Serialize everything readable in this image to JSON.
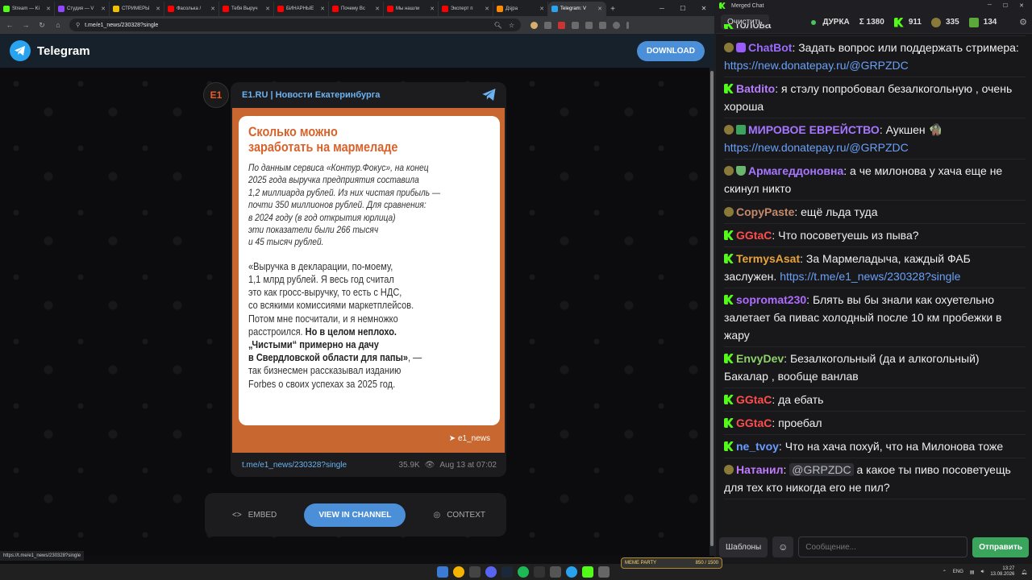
{
  "browser": {
    "tabs": [
      {
        "label": "Stream — Ki",
        "color": "#53fc18"
      },
      {
        "label": "Студия — V",
        "color": "#9146ff"
      },
      {
        "label": "СТРИМЕРЫ",
        "color": "#f0c000"
      },
      {
        "label": "Фасолька /",
        "color": "#ff0000"
      },
      {
        "label": "Тебя Выруч",
        "color": "#ff0000"
      },
      {
        "label": "БИНАРНЫЕ",
        "color": "#ff0000"
      },
      {
        "label": "Почему Вс",
        "color": "#ff0000"
      },
      {
        "label": "Мы нашли",
        "color": "#ff0000"
      },
      {
        "label": "Эксперт п",
        "color": "#ff0000"
      },
      {
        "label": "Дsjра",
        "color": "#ff8a00"
      },
      {
        "label": "Telegram: V",
        "color": "#2aa3ef"
      }
    ],
    "url": "t.me/e1_news/230328?single",
    "status_url": "https://t.me/e1_news/230328?single"
  },
  "telegram": {
    "title": "Telegram",
    "download_label": "DOWNLOAD",
    "avatar_text": "E1",
    "channel_name": "E1.RU | Новости Екатеринбурга",
    "card_title": "Сколько можно\nзаработать на мармеладе",
    "card_intro": "По данным сервиса «Контур.Фокус», на конец\n2025 года выручка предприятия составила\n1,2 миллиарда рублей. Из них чистая прибыль —\nпочти 350 миллионов рублей. Для сравнения:\nв 2024 году (в год открытия юрлица)\nэти показатели были 266 тысяч\nи 45 тысяч рублей.",
    "quote_plain": "«Выручка в декларации, по-моему,\n1,1 млрд рублей. Я весь год считал\nэто как гросс-выручку, то есть с НДС,\nсо всякими комиссиями маркетплейсов.\nПотом мне посчитали, и я немножко\nрасстроился. ",
    "quote_bold": "Но в целом неплохо.\n„Чистыми“ примерно на дачу\nв Свердловской области для папы»",
    "quote_tail": ", —\nтак бизнесмен рассказывал изданию\nForbes о своих успехах за 2025 год.",
    "source_badge": "e1_news",
    "post_link": "t.me/e1_news/230328?single",
    "views": "35.9K",
    "date": "Aug 13 at 07:02",
    "embed_label": "EMBED",
    "view_channel_label": "VIEW IN CHANNEL",
    "context_label": "CONTEXT"
  },
  "chat": {
    "window_title": "Merged Chat",
    "clear_label": "Очистить",
    "streamer": "ДУРКА",
    "total": "Σ 1380",
    "kick_count": "911",
    "mod_count": "335",
    "other_count": "134",
    "messages": [
      {
        "badges": [
          "kick"
        ],
        "user": "",
        "color": "#bf94ff",
        "text": "голова",
        "partial": true
      },
      {
        "badges": [
          "mod",
          "bot"
        ],
        "user": "ChatBot",
        "color": "#9b6bff",
        "text": "Задать вопрос или поддержать стримера: ",
        "link": "https://new.donatepay.ru/@GRPZDC"
      },
      {
        "badges": [
          "kick"
        ],
        "user": "Batdito",
        "color": "#b87cff",
        "text": "я стэлу попробовал безалкогольную , очень хороша"
      },
      {
        "badges": [
          "mod",
          "check"
        ],
        "user": "МИРОВОЕ ЕВРЕЙСТВО",
        "color": "#a676ff",
        "text": "Аукшен 🧌 ",
        "link": "https://new.donatepay.ru/@GRPZDC"
      },
      {
        "badges": [
          "mod",
          "shield"
        ],
        "user": "Армагеддоновна",
        "color": "#a876ff",
        "text": "а че милонова у хача еще не скинул никто"
      },
      {
        "badges": [
          "mod"
        ],
        "user": "CopyPaste",
        "color": "#c38a6a",
        "text": "ещё льда туда"
      },
      {
        "badges": [
          "kick"
        ],
        "user": "GGtaC",
        "color": "#ff4d4d",
        "text": "Что посоветуешь из пыва?"
      },
      {
        "badges": [
          "kick"
        ],
        "user": "TermysAsat",
        "color": "#e8a33a",
        "text": "За Мармеладыча, каждый ФАБ заслужен. ",
        "link": "https://t.me/e1_news/230328?single"
      },
      {
        "badges": [
          "kick"
        ],
        "user": "sopromat230",
        "color": "#b06bff",
        "text": "Блять вы бы знали как охуетельно залетает ба пивас холодный после 10 км пробежки в жару"
      },
      {
        "badges": [
          "kick"
        ],
        "user": "EnvyDev",
        "color": "#8ed16a",
        "text": "Безалкогольный (да и алкогольный) Бакалар , вообще ванлав"
      },
      {
        "badges": [
          "kick"
        ],
        "user": "GGtaC",
        "color": "#ff4d4d",
        "text": "да ебать"
      },
      {
        "badges": [
          "kick"
        ],
        "user": "GGtaC",
        "color": "#ff4d4d",
        "text": "проебал"
      },
      {
        "badges": [
          "kick"
        ],
        "user": "ne_tvoy",
        "color": "#6a9cff",
        "text": "Что на хача похуй, что на Милонова тоже"
      },
      {
        "badges": [
          "mod"
        ],
        "user": "Натанил",
        "color": "#c07bff",
        "mention": "@GRPZDC",
        "text": " а какое ты пиво посоветуещь для тех кто никогда его не пил?"
      }
    ],
    "templates_label": "Шаблоны",
    "input_placeholder": "Сообщение...",
    "send_label": "Отправить"
  },
  "taskbar": {
    "meme_label": "MEME PARTY",
    "meme_progress": "850 / 1500",
    "lang": "ENG",
    "time": "13:27",
    "date": "13.08.2026"
  }
}
